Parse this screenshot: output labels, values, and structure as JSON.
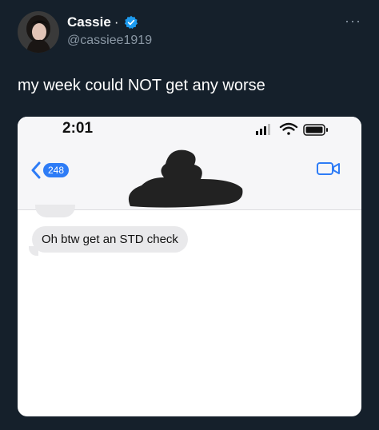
{
  "author": {
    "name": "Cassie",
    "separator": "·",
    "handle": "@cassiee1919"
  },
  "more_label": "···",
  "tweet": {
    "text": "my week could NOT get any worse"
  },
  "phone": {
    "time": "2:01",
    "unread_count": "248",
    "message_text": "Oh btw get an STD check"
  },
  "colors": {
    "background": "#15202b",
    "verified": "#1d9bf0",
    "ios_blue": "#2e7cf6",
    "bubble": "#e9e9eb"
  },
  "icons": [
    "verified-badge-icon",
    "more-icon",
    "signal-icon",
    "wifi-icon",
    "battery-icon",
    "back-chevron-icon",
    "video-call-icon"
  ]
}
